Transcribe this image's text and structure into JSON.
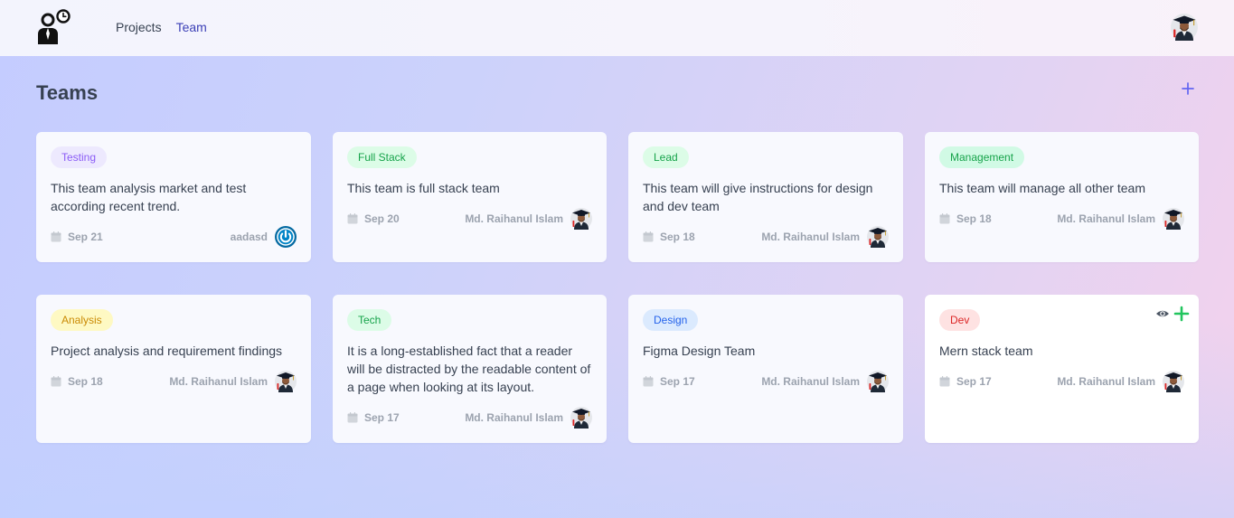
{
  "nav": {
    "projects_label": "Projects",
    "team_label": "Team"
  },
  "page": {
    "title": "Teams"
  },
  "colors": {
    "nav_active": "#3b3fb6",
    "add_button": "#6366f1"
  },
  "teams": [
    {
      "tag": "Testing",
      "tag_color": "#8b5cf6",
      "tag_bg": "#ede9fe",
      "description": "This team analysis market and test according recent trend.",
      "date": "Sep 21",
      "owner": "aadasd",
      "avatar_icon": "power-icon"
    },
    {
      "tag": "Full Stack",
      "tag_color": "#16a34a",
      "tag_bg": "#dcfce7",
      "description": "This team is full stack team",
      "date": "Sep 20",
      "owner": "Md. Raihanul Islam",
      "avatar_icon": "graduate-avatar"
    },
    {
      "tag": "Lead",
      "tag_color": "#16a34a",
      "tag_bg": "#dcfce7",
      "description": "This team will give instructions for design and dev team",
      "date": "Sep 18",
      "owner": "Md. Raihanul Islam",
      "avatar_icon": "graduate-avatar"
    },
    {
      "tag": "Management",
      "tag_color": "#16a34a",
      "tag_bg": "#d1fae5",
      "description": "This team will manage all other team",
      "date": "Sep 18",
      "owner": "Md. Raihanul Islam",
      "avatar_icon": "graduate-avatar"
    },
    {
      "tag": "Analysis",
      "tag_color": "#ca8a04",
      "tag_bg": "#fef9c3",
      "description": "Project analysis and requirement findings",
      "date": "Sep 18",
      "owner": "Md. Raihanul Islam",
      "avatar_icon": "graduate-avatar"
    },
    {
      "tag": "Tech",
      "tag_color": "#16a34a",
      "tag_bg": "#dcfce7",
      "description": "It is a long-established fact that a reader will be distracted by the readable content of a page when looking at its layout.",
      "date": "Sep 17",
      "owner": "Md. Raihanul Islam",
      "avatar_icon": "graduate-avatar"
    },
    {
      "tag": "Design",
      "tag_color": "#2563eb",
      "tag_bg": "#dbeafe",
      "description": "Figma Design Team",
      "date": "Sep 17",
      "owner": "Md. Raihanul Islam",
      "avatar_icon": "graduate-avatar"
    },
    {
      "tag": "Dev",
      "tag_color": "#dc2626",
      "tag_bg": "#fee2e2",
      "description": "Mern stack team",
      "date": "Sep 17",
      "owner": "Md. Raihanul Islam",
      "avatar_icon": "graduate-avatar",
      "actions": [
        "eye-icon",
        "plus-icon"
      ]
    }
  ]
}
